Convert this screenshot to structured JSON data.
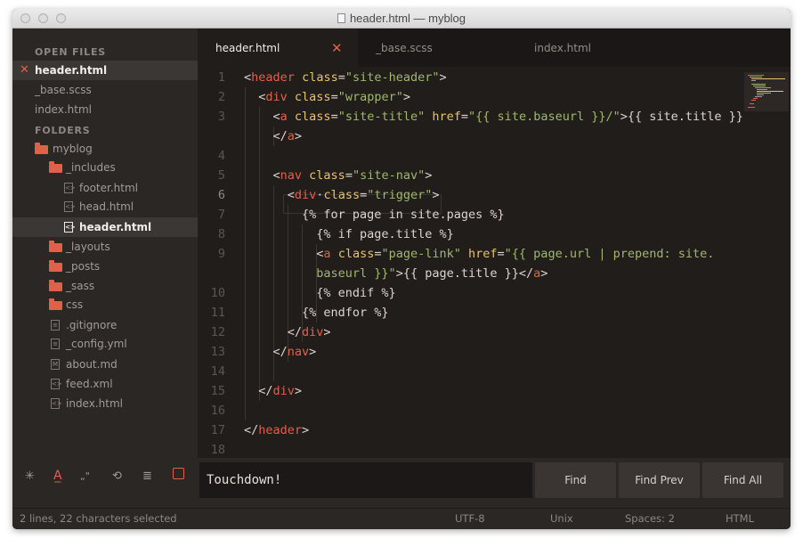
{
  "window": {
    "title": "header.html — myblog"
  },
  "sidebar": {
    "open_files_heading": "OPEN FILES",
    "open_files": [
      {
        "label": "header.html",
        "active": true
      },
      {
        "label": "_base.scss"
      },
      {
        "label": "index.html"
      }
    ],
    "folders_heading": "FOLDERS",
    "tree": [
      {
        "label": "myblog",
        "kind": "folder"
      },
      {
        "label": "_includes",
        "kind": "folder"
      },
      {
        "label": "footer.html",
        "kind": "file"
      },
      {
        "label": "head.html",
        "kind": "file"
      },
      {
        "label": "header.html",
        "kind": "file",
        "active": true
      },
      {
        "label": "_layouts",
        "kind": "folder"
      },
      {
        "label": "_posts",
        "kind": "folder"
      },
      {
        "label": "_sass",
        "kind": "folder"
      },
      {
        "label": "css",
        "kind": "folder"
      },
      {
        "label": ".gitignore",
        "kind": "file"
      },
      {
        "label": "_config.yml",
        "kind": "file"
      },
      {
        "label": "about.md",
        "kind": "file"
      },
      {
        "label": "feed.xml",
        "kind": "file"
      },
      {
        "label": "index.html",
        "kind": "file"
      }
    ]
  },
  "tabs": [
    {
      "label": "header.html",
      "active": true
    },
    {
      "label": "_base.scss"
    },
    {
      "label": "index.html"
    }
  ],
  "editor": {
    "line_numbers": [
      "1",
      "2",
      "3",
      "",
      "4",
      "5",
      "6",
      "7",
      "8",
      "9",
      "",
      "10",
      "11",
      "12",
      "13",
      "14",
      "15",
      "16",
      "17",
      "18"
    ],
    "current_line": "6"
  },
  "find": {
    "query": "Touchdown!",
    "find_label": "Find",
    "find_prev_label": "Find Prev",
    "find_all_label": "Find All"
  },
  "status": {
    "selection": "2 lines, 22 characters selected",
    "encoding": "UTF-8",
    "line_endings": "Unix",
    "indentation": "Spaces: 2",
    "syntax": "HTML"
  },
  "icons": {
    "regex": "asterisk-icon",
    "case": "case-sensitive-icon",
    "word": "whole-word-icon",
    "wrap": "wrap-icon",
    "selection": "in-selection-icon",
    "highlight": "highlight-matches-icon"
  },
  "colors": {
    "accent": "#e0614a",
    "string": "#9fb86b",
    "attribute": "#e7c36b",
    "background": "#211d1b",
    "sidebar": "#2b2725"
  }
}
